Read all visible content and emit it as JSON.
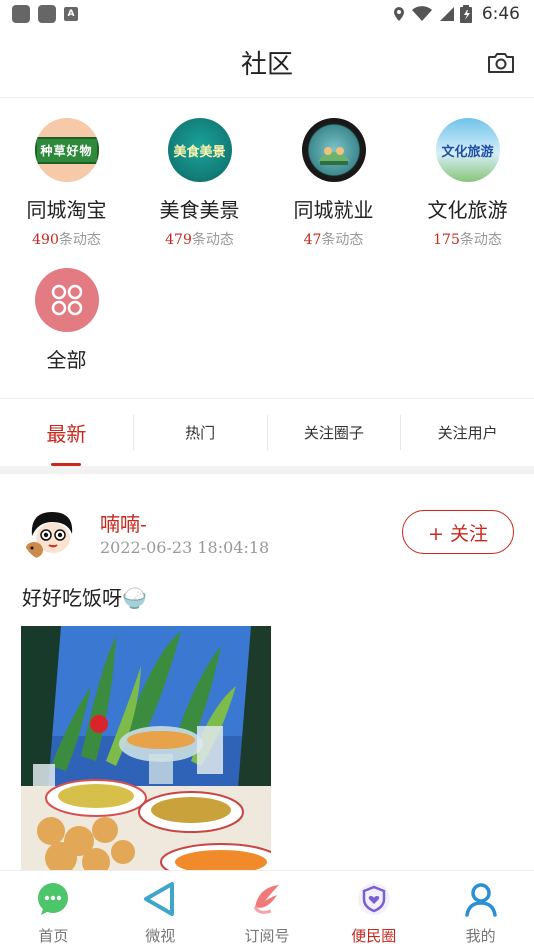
{
  "status_bar": {
    "time": "6:46",
    "notif_letter": "A"
  },
  "header": {
    "title": "社区"
  },
  "categories": [
    {
      "name": "同城淘宝",
      "count": "490",
      "suffix": "条动态",
      "icon_text": "种草好物"
    },
    {
      "name": "美食美景",
      "count": "479",
      "suffix": "条动态",
      "icon_text": "美食美景"
    },
    {
      "name": "同城就业",
      "count": "47",
      "suffix": "条动态"
    },
    {
      "name": "文化旅游",
      "count": "175",
      "suffix": "条动态",
      "icon_text": "文化旅游"
    },
    {
      "name": "全部"
    }
  ],
  "tabs": [
    "最新",
    "热门",
    "关注圈子",
    "关注用户"
  ],
  "post": {
    "username": "喃喃-",
    "time": "2022-06-23 18:04:18",
    "follow_label": "+ 关注",
    "text": "好好吃饭呀🍚"
  },
  "bottom_nav": [
    {
      "label": "首页",
      "icon": "chat-bubble-icon"
    },
    {
      "label": "微视",
      "icon": "play-icon"
    },
    {
      "label": "订阅号",
      "icon": "feather-icon"
    },
    {
      "label": "便民圈",
      "icon": "shield-heart-icon",
      "active": true
    },
    {
      "label": "我的",
      "icon": "user-icon"
    }
  ],
  "colors": {
    "accent": "#c8281e",
    "text": "#222222",
    "muted": "#999999"
  }
}
